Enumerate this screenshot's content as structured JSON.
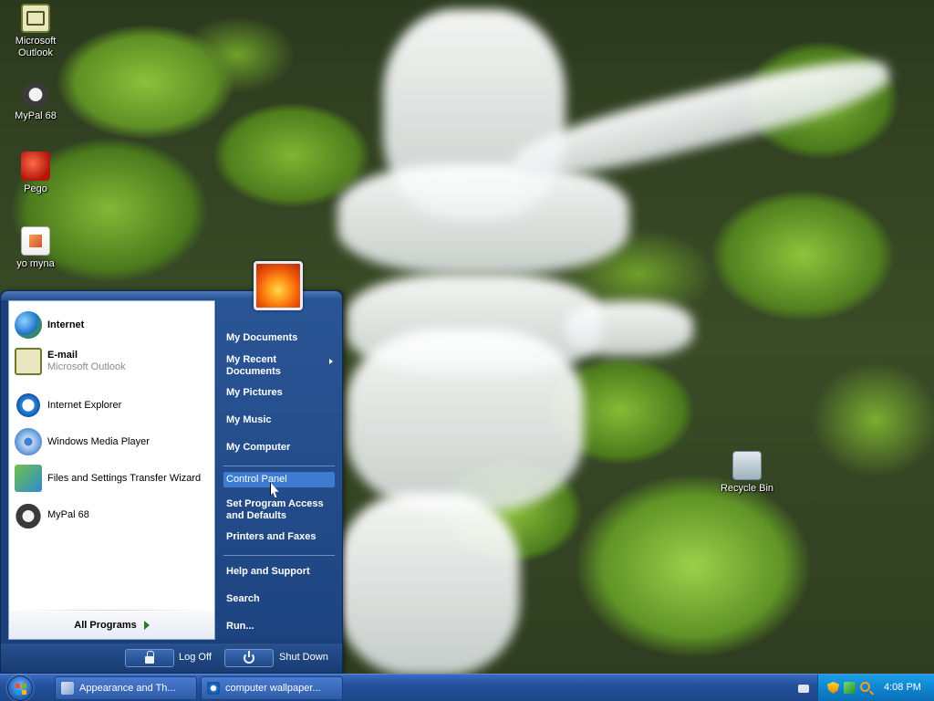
{
  "desktop": {
    "icons": [
      {
        "label": "Microsoft Outlook",
        "icon": "outlook-icon"
      },
      {
        "label": "MyPal 68",
        "icon": "raccoon-icon"
      },
      {
        "label": "Pego",
        "icon": "pego-icon"
      },
      {
        "label": "yo myna",
        "icon": "document-icon"
      },
      {
        "label": "Recycle Bin",
        "icon": "recycle-bin-icon"
      }
    ]
  },
  "start_menu": {
    "left_items": [
      {
        "label": "Internet",
        "sub": "",
        "icon": "globe-icon"
      },
      {
        "label": "E-mail",
        "sub": "Microsoft Outlook",
        "icon": "mail-icon"
      },
      {
        "label": "Internet Explorer",
        "sub": "",
        "icon": "internet-explorer-icon"
      },
      {
        "label": "Windows Media Player",
        "sub": "",
        "icon": "media-player-icon"
      },
      {
        "label": "Files and Settings Transfer Wizard",
        "sub": "",
        "icon": "transfer-wizard-icon"
      },
      {
        "label": "MyPal 68",
        "sub": "",
        "icon": "raccoon-icon"
      }
    ],
    "all_programs": "All Programs",
    "right_items": [
      {
        "label": "My Documents"
      },
      {
        "label": "My Recent Documents"
      },
      {
        "label": "My Pictures"
      },
      {
        "label": "My Music"
      },
      {
        "label": "My Computer"
      },
      {
        "label": "Control Panel"
      },
      {
        "label": "Set Program Access and Defaults"
      },
      {
        "label": "Printers and Faxes"
      },
      {
        "label": "Help and Support"
      },
      {
        "label": "Search"
      },
      {
        "label": "Run..."
      }
    ],
    "highlighted": "Control Panel",
    "log_off": "Log Off",
    "shut_down": "Shut Down"
  },
  "taskbar": {
    "buttons": [
      {
        "label": "Appearance and Th...",
        "icon": "control-panel-icon"
      },
      {
        "label": "computer wallpaper...",
        "icon": "internet-explorer-icon"
      }
    ],
    "clock": "4:08 PM"
  }
}
